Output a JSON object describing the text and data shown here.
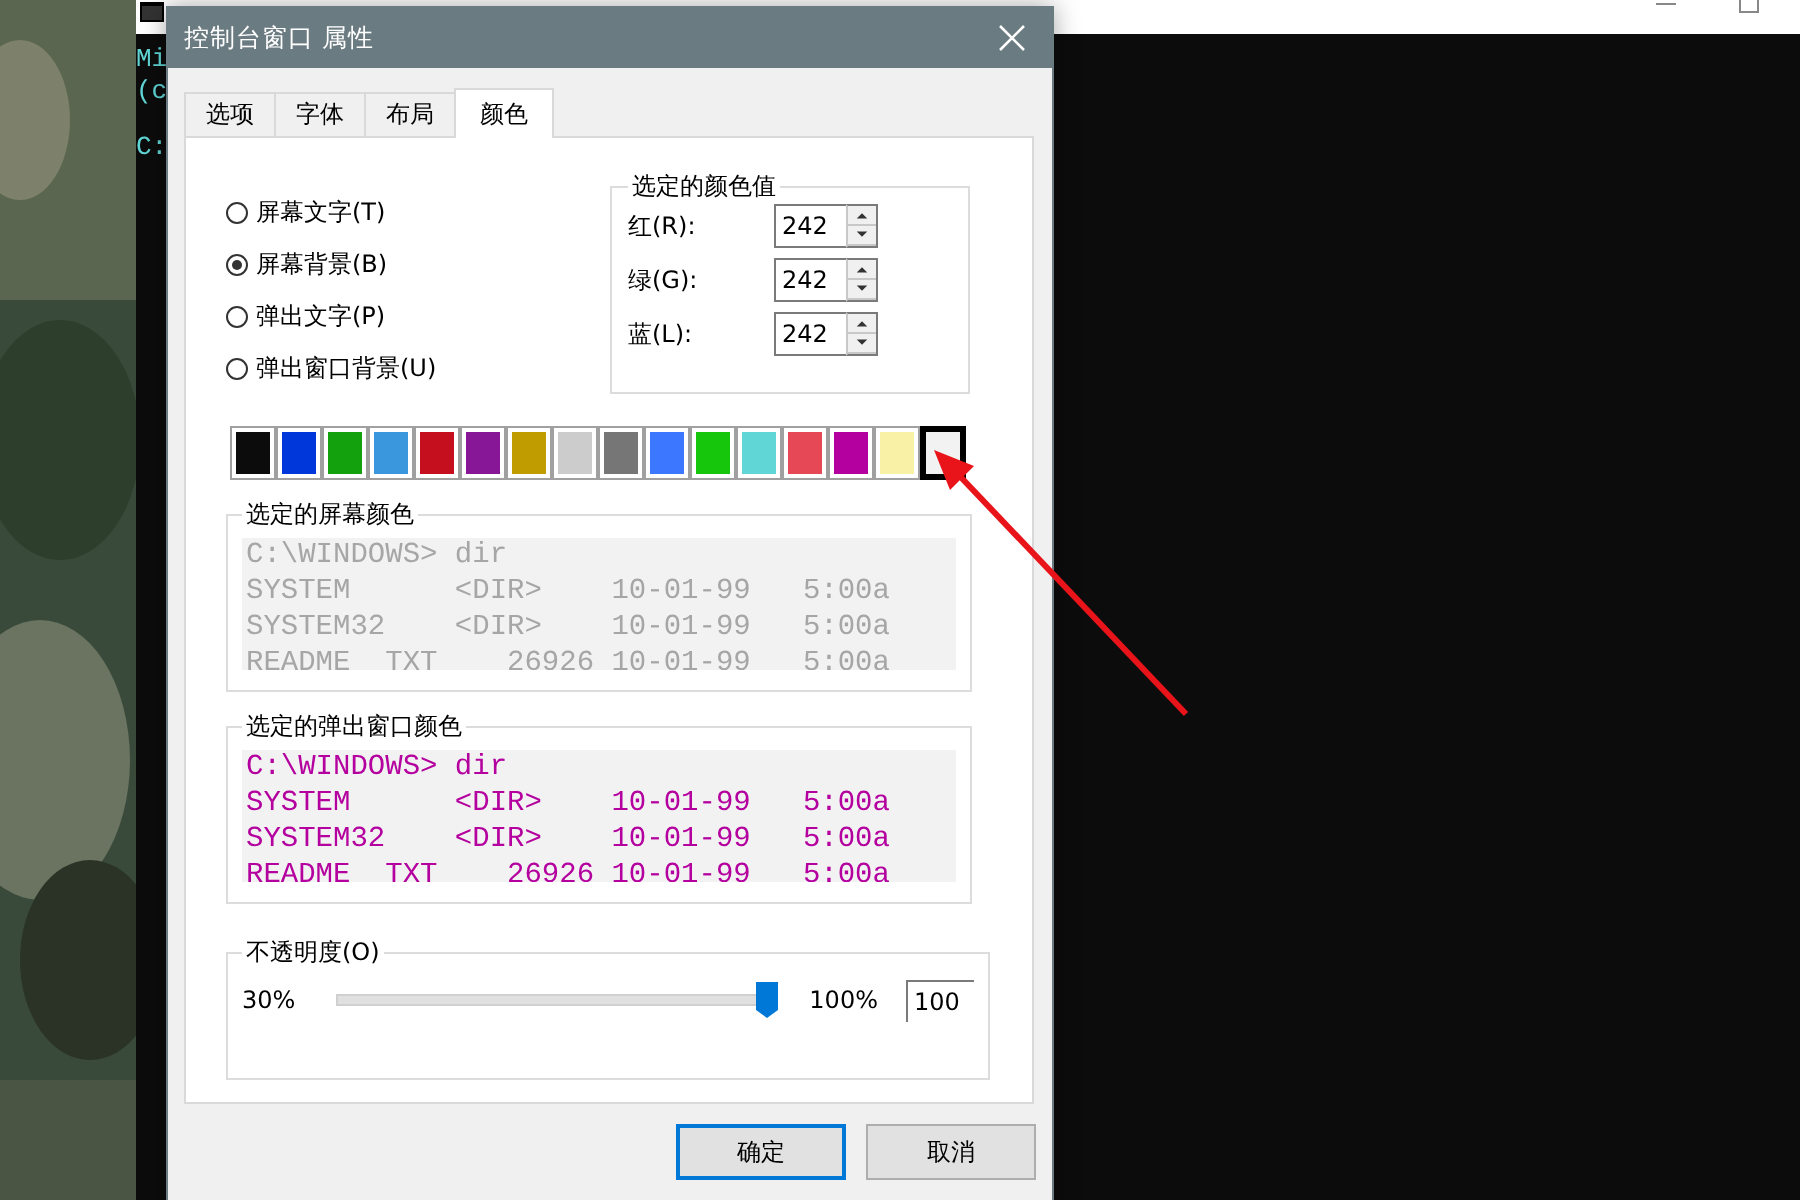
{
  "console_window": {
    "lines": [
      "Mi",
      "(c",
      "C:"
    ]
  },
  "dialog": {
    "title": "控制台窗口 属性",
    "tabs": [
      {
        "label": "选项",
        "selected": false
      },
      {
        "label": "字体",
        "selected": false
      },
      {
        "label": "布局",
        "selected": false
      },
      {
        "label": "颜色",
        "selected": true
      }
    ],
    "radios": [
      {
        "label": "屏幕文字(T)",
        "selected": false
      },
      {
        "label": "屏幕背景(B)",
        "selected": true
      },
      {
        "label": "弹出文字(P)",
        "selected": false
      },
      {
        "label": "弹出窗口背景(U)",
        "selected": false
      }
    ],
    "color_values": {
      "title": "选定的颜色值",
      "fields": [
        {
          "label": "红(R):",
          "value": "242"
        },
        {
          "label": "绿(G):",
          "value": "242"
        },
        {
          "label": "蓝(L):",
          "value": "242"
        }
      ]
    },
    "palette": [
      {
        "color": "#0c0c0c",
        "selected": false
      },
      {
        "color": "#0037da",
        "selected": false
      },
      {
        "color": "#13a10e",
        "selected": false
      },
      {
        "color": "#3a96dd",
        "selected": false
      },
      {
        "color": "#c50f1f",
        "selected": false
      },
      {
        "color": "#881798",
        "selected": false
      },
      {
        "color": "#c19c00",
        "selected": false
      },
      {
        "color": "#cccccc",
        "selected": false
      },
      {
        "color": "#767676",
        "selected": false
      },
      {
        "color": "#3b78ff",
        "selected": false
      },
      {
        "color": "#16c60c",
        "selected": false
      },
      {
        "color": "#61d6d6",
        "selected": false
      },
      {
        "color": "#e74856",
        "selected": false
      },
      {
        "color": "#b4009e",
        "selected": false
      },
      {
        "color": "#f9f1a5",
        "selected": false
      },
      {
        "color": "#f2f2f2",
        "selected": true
      }
    ],
    "previews": [
      {
        "title": "选定的屏幕颜色",
        "kind": "screen",
        "lines": [
          "C:\\WINDOWS> dir",
          "SYSTEM      <DIR>    10-01-99   5:00a",
          "SYSTEM32    <DIR>    10-01-99   5:00a",
          "README  TXT    26926 10-01-99   5:00a"
        ]
      },
      {
        "title": "选定的弹出窗口颜色",
        "kind": "popup",
        "lines": [
          "C:\\WINDOWS> dir",
          "SYSTEM      <DIR>    10-01-99   5:00a",
          "SYSTEM32    <DIR>    10-01-99   5:00a",
          "README  TXT    26926 10-01-99   5:00a"
        ]
      }
    ],
    "opacity": {
      "title": "不透明度(O)",
      "min_label": "30%",
      "max_label": "100%",
      "level": 1,
      "value": "100"
    },
    "buttons": [
      {
        "label": "确定",
        "default": true
      },
      {
        "label": "取消",
        "default": false
      }
    ]
  }
}
